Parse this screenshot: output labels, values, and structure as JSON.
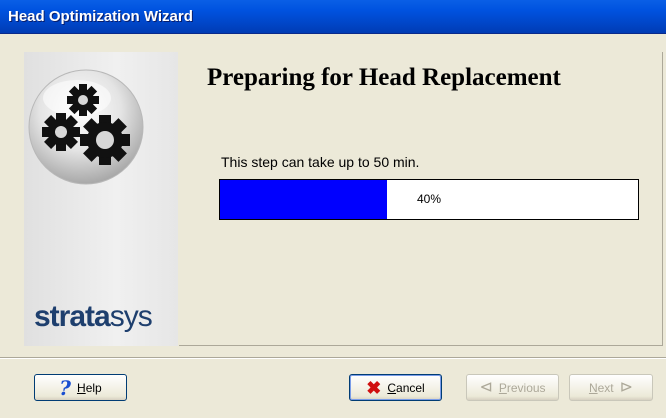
{
  "window": {
    "title": "Head Optimization Wizard"
  },
  "branding": {
    "logo_bold": "strata",
    "logo_thin": "sys"
  },
  "step": {
    "title": "Preparing for Head Replacement",
    "description": "This step can take up to 50 min."
  },
  "progress": {
    "value_percent": 40,
    "label": "40%",
    "fill_color": "#0000ff"
  },
  "buttons": {
    "help": {
      "label": "Help",
      "mnemonic": "H"
    },
    "cancel": {
      "label": "Cancel",
      "mnemonic": "C"
    },
    "previous": {
      "label": "Previous",
      "mnemonic": "P",
      "enabled": false
    },
    "next": {
      "label": "Next",
      "mnemonic": "N",
      "enabled": false
    }
  },
  "icons": {
    "gears": "gears-icon",
    "help": "question-mark-icon",
    "cancel": "x-icon",
    "previous": "left-arrow-icon",
    "next": "right-arrow-icon"
  }
}
